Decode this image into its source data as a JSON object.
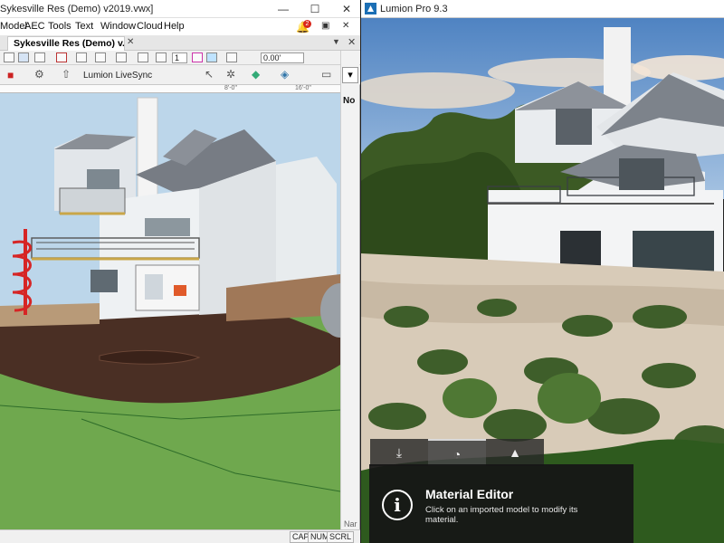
{
  "vectorworks": {
    "title": "Sykesville Res (Demo) v2019.vwx]",
    "window_buttons": {
      "minimize": "—",
      "maximize": "☐",
      "close": "✕"
    },
    "menu": [
      "Model",
      "AEC",
      "Tools",
      "Text",
      "Window",
      "Cloud",
      "Help"
    ],
    "notification_count": "2",
    "menu_controls": {
      "restore": "▣",
      "close": "✕"
    },
    "document_tab": "Sykesville Res (Demo) v...",
    "tab_close": "✕",
    "tab_arrow": "▼",
    "tab_x": "✕",
    "toolbar": {
      "layer_number": "1",
      "offset_value": "0.00'",
      "livesync_label": "Lumion LiveSync"
    },
    "ruler_ticks": [
      "8'-0\"",
      "16'-0\""
    ],
    "side_nav": {
      "mini": "▾",
      "label": "No",
      "bottom": "Nar"
    },
    "status": [
      "CAP",
      "NUM",
      "SCRL"
    ]
  },
  "lumion": {
    "title": "Lumion Pro 9.3",
    "window_buttons": {
      "minimize": "—",
      "maximize": "☐",
      "close": "✕"
    },
    "bottom_tabs": [
      {
        "name": "import",
        "icon": "import-icon"
      },
      {
        "name": "material",
        "icon": "material-icon"
      },
      {
        "name": "landscape",
        "icon": "landscape-icon"
      }
    ],
    "tooltip": {
      "icon": "i",
      "title": "Material Editor",
      "body": "Click on an imported model to modify its material."
    }
  },
  "colors": {
    "vw_sky": "#bcd6ea",
    "vw_grass": "#6fa84e",
    "vw_dirt": "#4a2f24",
    "lumion_sky": "#5b8cc7",
    "notification": "#d9261c"
  }
}
